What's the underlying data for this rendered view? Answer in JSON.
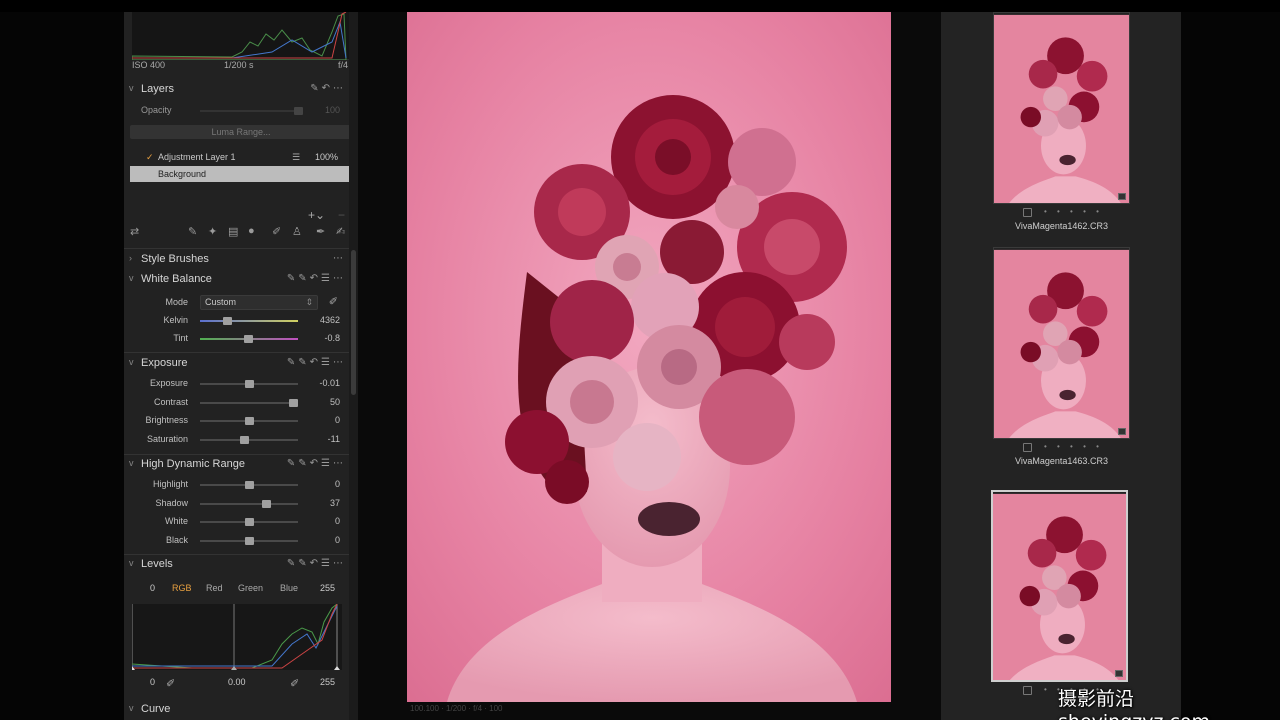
{
  "histogram": {
    "iso": "ISO 400",
    "shutter": "1/200 s",
    "aperture": "f/4"
  },
  "layers": {
    "title": "Layers",
    "opacity_label": "Opacity",
    "opacity_value": "100",
    "luma_range_label": "Luma Range...",
    "items": [
      {
        "name": "Adjustment Layer 1",
        "opacity": "100%",
        "checked": true
      },
      {
        "name": "Background",
        "selected": true
      }
    ]
  },
  "style_brushes": {
    "title": "Style Brushes"
  },
  "white_balance": {
    "title": "White Balance",
    "mode_label": "Mode",
    "mode_value": "Custom",
    "kelvin_label": "Kelvin",
    "kelvin_value": "4362",
    "kelvin_level": 0.28,
    "tint_label": "Tint",
    "tint_value": "-0.8",
    "tint_level": 0.49
  },
  "exposure": {
    "title": "Exposure",
    "sliders": [
      {
        "label": "Exposure",
        "value": "-0.01",
        "level": 0.5
      },
      {
        "label": "Contrast",
        "value": "50",
        "level": 0.95
      },
      {
        "label": "Brightness",
        "value": "0",
        "level": 0.5
      },
      {
        "label": "Saturation",
        "value": "-11",
        "level": 0.45
      }
    ]
  },
  "hdr": {
    "title": "High Dynamic Range",
    "sliders": [
      {
        "label": "Highlight",
        "value": "0",
        "level": 0.5
      },
      {
        "label": "Shadow",
        "value": "37",
        "level": 0.67
      },
      {
        "label": "White",
        "value": "0",
        "level": 0.5
      },
      {
        "label": "Black",
        "value": "0",
        "level": 0.5
      }
    ]
  },
  "levels": {
    "title": "Levels",
    "input_low": "0",
    "input_high": "255",
    "channels": [
      "RGB",
      "Red",
      "Green",
      "Blue"
    ],
    "active_channel": "RGB",
    "output_low": "0",
    "midpoint": "0.00",
    "output_high": "255"
  },
  "curve": {
    "title": "Curve"
  },
  "browser": {
    "thumbnails": [
      {
        "filename": "VivaMagenta1462.CR3",
        "dots": "• • • • •"
      },
      {
        "filename": "VivaMagenta1463.CR3",
        "dots": "• • • • •"
      },
      {
        "filename": "",
        "dots": "• • • • •",
        "selected": true
      }
    ]
  },
  "viewer_status": "100.100 · 1/200 · f/4 · 100",
  "watermark": "摄影前沿 sheyingzyz.com",
  "colors": {
    "accent": "#e8a040",
    "panel": "#222222",
    "photo_bg": "#e07ea0",
    "rose_dark": "#8c1230",
    "rose_light": "#d88aa0"
  }
}
